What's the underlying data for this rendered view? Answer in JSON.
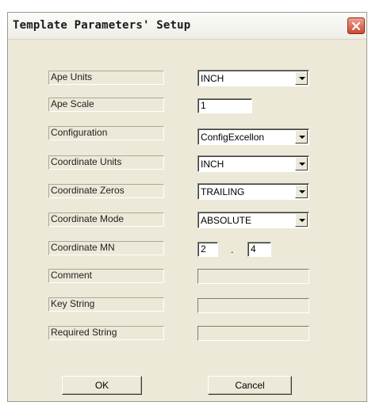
{
  "window": {
    "title": "Template Parameters' Setup"
  },
  "icons": {
    "close": "close-icon",
    "dropdown": "chevron-down-icon"
  },
  "fields": {
    "ape_units": {
      "label": "Ape Units",
      "value": "INCH"
    },
    "ape_scale": {
      "label": "Ape Scale",
      "value": "1"
    },
    "configuration": {
      "label": "Configuration",
      "value": "ConfigExcellon"
    },
    "coordinate_units": {
      "label": "Coordinate Units",
      "value": "INCH"
    },
    "coordinate_zeros": {
      "label": "Coordinate Zeros",
      "value": "TRAILING"
    },
    "coordinate_mode": {
      "label": "Coordinate Mode",
      "value": "ABSOLUTE"
    },
    "coordinate_mn": {
      "label": "Coordinate MN",
      "m": "2",
      "separator": ".",
      "n": "4"
    },
    "comment": {
      "label": "Comment",
      "value": ""
    },
    "key_string": {
      "label": "Key String",
      "value": ""
    },
    "required_string": {
      "label": "Required String",
      "value": ""
    }
  },
  "buttons": {
    "ok": "OK",
    "cancel": "Cancel"
  },
  "colors": {
    "dialog_bg": "#ece9d8",
    "close_red": "#c94b30"
  }
}
